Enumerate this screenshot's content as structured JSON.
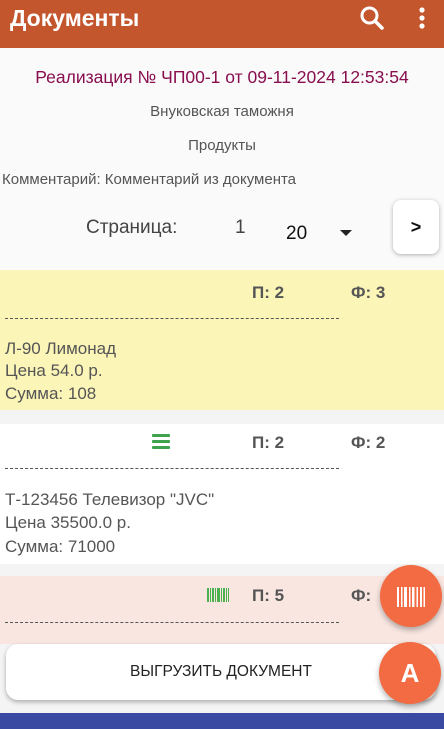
{
  "appbar": {
    "title": "Документы",
    "search_icon": "search-icon",
    "menu_icon": "more-vert-icon",
    "color": "#c4562e"
  },
  "document": {
    "title": "Реализация № ЧП00-1 от 09-11-2024 12:53:54",
    "warehouse": "Внуковская таможня",
    "type": "Продукты",
    "comment": "Комментарий: Комментарий из документа"
  },
  "pager": {
    "label": "Страница:",
    "page": "1",
    "page_size": "20",
    "next_label": ">"
  },
  "items": [
    {
      "plan": "П: 2",
      "fact": "Ф: 3",
      "name": "Л-90 Лимонад",
      "price": "Цена 54.0 р.",
      "sum": "Сумма: 108",
      "color": "#fbf5b8"
    },
    {
      "plan": "П: 2",
      "fact": "Ф: 2",
      "name": "Т-123456 Телевизор \"JVC\"",
      "price": "Цена 35500.0 р.",
      "sum": "Сумма: 71000",
      "icon": "list-lines-icon",
      "color": "#ffffff"
    },
    {
      "plan": "П: 5",
      "fact": "Ф:",
      "icon": "barcode-icon",
      "color": "#f9e6e1"
    }
  ],
  "actions": {
    "upload_label": "ВЫГРУЗИТЬ ДОКУМЕНТ",
    "fab_letter": "A",
    "scan_icon": "barcode-scan-icon",
    "accent": "#f26b43"
  },
  "nav_bar_color": "#3a4aa3"
}
